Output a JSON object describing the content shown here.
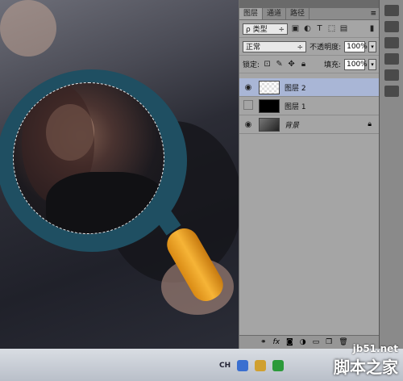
{
  "layers_panel": {
    "tabs": [
      "图层",
      "通道",
      "路径"
    ],
    "active_tab": "图层",
    "filter_label": "ρ 类型",
    "blend_mode": "正常",
    "opacity_label": "不透明度:",
    "opacity_value": "100%",
    "lock_label": "锁定:",
    "fill_label": "填充:",
    "fill_value": "100%",
    "layers": [
      {
        "name": "图层 2",
        "visible": true,
        "selected": true
      },
      {
        "name": "图层 1",
        "visible": false,
        "selected": false
      },
      {
        "name": "背景",
        "visible": true,
        "selected": false,
        "locked": true
      }
    ],
    "bottom_icons": [
      "link-icon",
      "fx-icon",
      "mask-icon",
      "adjustment-icon",
      "folder-icon",
      "new-layer-icon",
      "trash-icon"
    ]
  },
  "taskbar": {
    "lang": "CH"
  },
  "watermark": {
    "site": "jb51.net",
    "name": "脚本之家"
  },
  "colors": {
    "ring": "#1f4f62",
    "handle": "#f6b437",
    "panel_bg": "#a5a5a5",
    "selected_layer": "#a9b6d6"
  }
}
